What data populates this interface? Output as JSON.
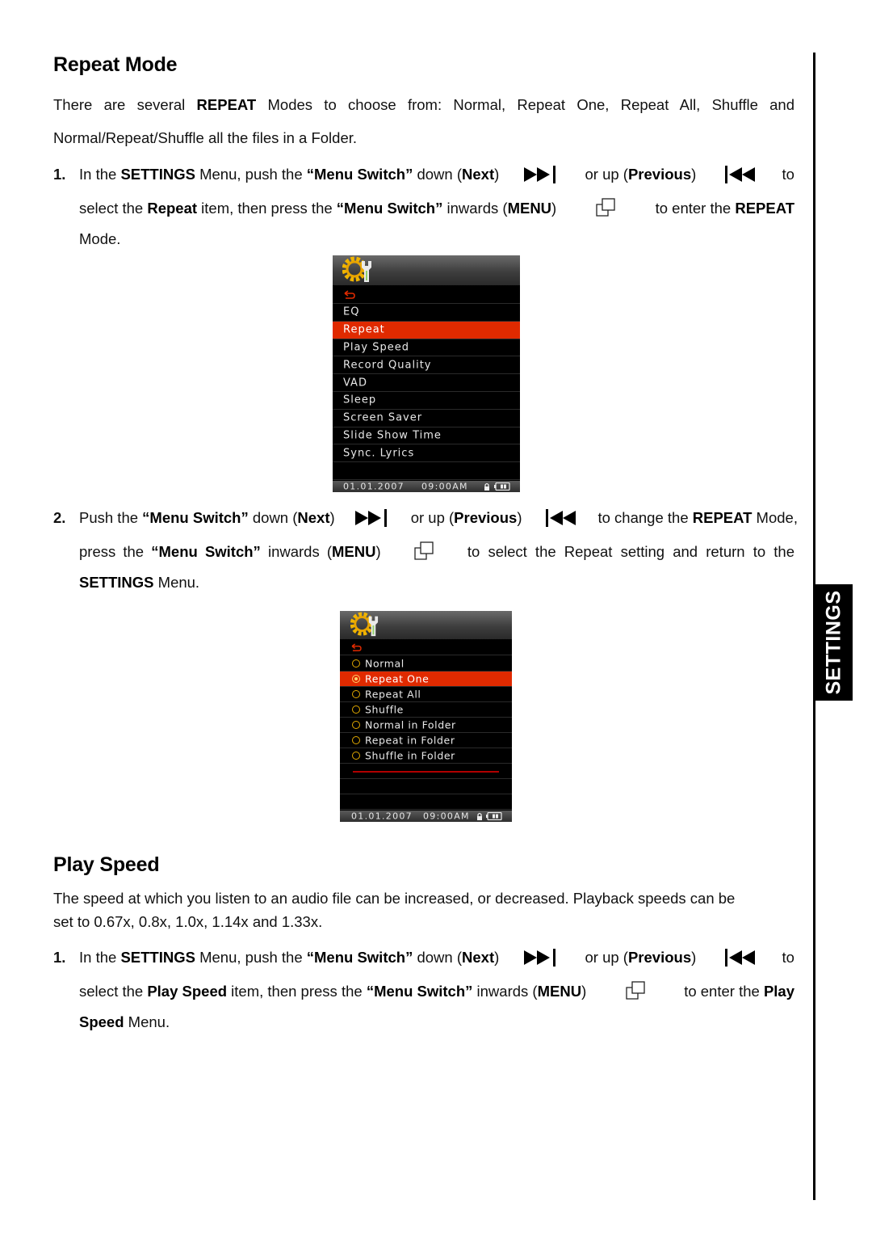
{
  "section_repeat": {
    "title": "Repeat Mode",
    "intro": {
      "t1": "There are several ",
      "b1": "REPEAT",
      "t2": " Modes to choose from: Normal, Repeat One, Repeat All, Shuffle and",
      "line2": "Normal/Repeat/Shuffle all the files in a Folder."
    },
    "step1": {
      "number": "1.",
      "l1": {
        "t1": "In the ",
        "b1": "SETTINGS",
        "t2": " Menu, push the ",
        "b2": "“Menu Switch”",
        "t3": " down (",
        "b3": "Next",
        "t4": ")",
        "t5": "or up (",
        "b4": "Previous",
        "t6": ")",
        "t7": "to"
      },
      "l2": {
        "t1": "select the ",
        "b1": "Repeat",
        "t2": " item, then press the ",
        "b2": "“Menu Switch”",
        "t3": " inwards (",
        "b3": "MENU",
        "t4": ")",
        "t5": "to enter the ",
        "b4": "REPEAT"
      },
      "l3": "Mode."
    },
    "step2": {
      "number": "2.",
      "l1": {
        "t1": "Push the ",
        "b1": "“Menu Switch”",
        "t2": " down (",
        "b2": "Next",
        "t3": ")",
        "t4": "or up (",
        "b3": "Previous",
        "t5": ")",
        "t6": "to change the ",
        "b4": "REPEAT",
        "t7": " Mode,"
      },
      "l2": {
        "t1": "press the ",
        "b1": "“Menu Switch”",
        "t2": " inwards (",
        "b2": "MENU",
        "t3": ")",
        "t4": "to select the Repeat setting and return to the"
      },
      "l3": {
        "b1": "SETTINGS",
        "t1": " Menu."
      }
    }
  },
  "screen_settings": {
    "header_icon": "settings-gear-wrench-icon",
    "back_icon": "back-arrow-icon",
    "items": [
      "EQ",
      "Repeat",
      "Play Speed",
      "Record Quality",
      "VAD",
      "Sleep",
      "Screen Saver",
      "Slide Show Time",
      "Sync. Lyrics"
    ],
    "selected": "Repeat",
    "status": {
      "date": "01.01.2007",
      "time": "09:00AM",
      "lock_icon": "lock-icon",
      "battery_icon": "battery-icon"
    }
  },
  "screen_repeat": {
    "header_icon": "settings-gear-wrench-icon",
    "back_icon": "back-arrow-icon",
    "options": [
      "Normal",
      "Repeat One",
      "Repeat All",
      "Shuffle",
      "Normal in Folder",
      "Repeat in Folder",
      "Shuffle in Folder"
    ],
    "selected": "Repeat One",
    "status": {
      "date": "01.01.2007",
      "time": "09:00AM",
      "lock_icon": "lock-icon",
      "battery_icon": "battery-icon"
    }
  },
  "section_playspeed": {
    "title": "Play Speed",
    "intro": {
      "line1": "The speed at which you listen to an audio file can be increased, or decreased. Playback speeds can be",
      "line2": "set to 0.67x, 0.8x, 1.0x, 1.14x and 1.33x."
    },
    "step1": {
      "number": "1.",
      "l1": {
        "t1": "In the ",
        "b1": "SETTINGS",
        "t2": " Menu, push the ",
        "b2": "“Menu Switch”",
        "t3": " down (",
        "b3": "Next",
        "t4": ")",
        "t5": "or up (",
        "b4": "Previous",
        "t6": ")",
        "t7": "to"
      },
      "l2": {
        "t1": "select the ",
        "b1": "Play Speed",
        "t2": " item, then press the ",
        "b2": "“Menu Switch”",
        "t3": " inwards (",
        "b3": "MENU",
        "t4": ")",
        "t5": "to enter the ",
        "b4": "Play"
      },
      "l3": {
        "b1": "Speed",
        "t1": " Menu."
      }
    }
  },
  "side_tab": {
    "label": "SETTINGS"
  },
  "icons": {
    "next": "next-track-icon",
    "previous": "previous-track-icon",
    "menu": "menu-button-icon"
  }
}
